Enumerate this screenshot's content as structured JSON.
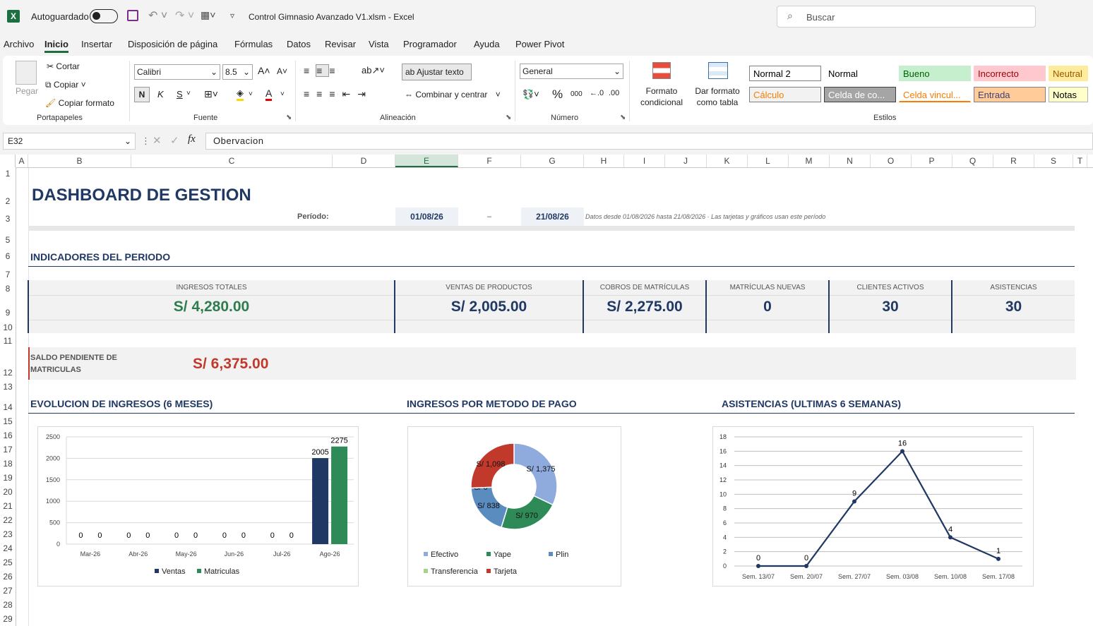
{
  "titlebar": {
    "autosave_label": "Autoguardado",
    "file_title": "Control Gimnasio Avanzado V1.xlsm  -  Excel",
    "search_placeholder": "Buscar",
    "logo": "X"
  },
  "menu": [
    "Archivo",
    "Inicio",
    "Insertar",
    "Disposición de página",
    "Fórmulas",
    "Datos",
    "Revisar",
    "Vista",
    "Programador",
    "Ayuda",
    "Power Pivot"
  ],
  "ribbon": {
    "clipboard": {
      "paste": "Pegar",
      "cut": "Cortar",
      "copy": "Copiar",
      "format_painter": "Copiar formato",
      "group": "Portapapeles"
    },
    "font": {
      "name": "Calibri",
      "size": "8.5",
      "bold": "N",
      "italic": "K",
      "underline": "S",
      "group": "Fuente"
    },
    "alignment": {
      "wrap": "Ajustar texto",
      "merge": "Combinar y centrar",
      "group": "Alineación"
    },
    "number": {
      "format": "General",
      "group": "Número",
      "percent": "%",
      "thousands": "000"
    },
    "styles": {
      "cond_format": "Formato condicional",
      "format_table": "Dar formato como tabla",
      "group": "Estilos",
      "cells": [
        {
          "label": "Normal 2",
          "bg": "#ffffff",
          "fg": "#000000",
          "border": "#7f7f7f"
        },
        {
          "label": "Normal",
          "bg": "#ffffff",
          "fg": "#000000",
          "border": "#ffffff"
        },
        {
          "label": "Bueno",
          "bg": "#c6efce",
          "fg": "#006100",
          "border": "#c6efce"
        },
        {
          "label": "Incorrecto",
          "bg": "#ffc7ce",
          "fg": "#9c0006",
          "border": "#ffc7ce"
        },
        {
          "label": "Neutral",
          "bg": "#ffeb9c",
          "fg": "#9c5700",
          "border": "#ffeb9c"
        },
        {
          "label": "Cálculo",
          "bg": "#f2f2f2",
          "fg": "#fa7d00",
          "border": "#7f7f7f"
        },
        {
          "label": "Celda de co...",
          "bg": "#a5a5a5",
          "fg": "#ffffff",
          "border": "#3f3f3f"
        },
        {
          "label": "Celda vincul...",
          "bg": "#ffffff",
          "fg": "#fa7d00",
          "border": "#ffffff"
        },
        {
          "label": "Entrada",
          "bg": "#ffcc99",
          "fg": "#3f3f76",
          "border": "#7f7f7f"
        },
        {
          "label": "Notas",
          "bg": "#ffffcc",
          "fg": "#000000",
          "border": "#b2b2b2"
        }
      ]
    }
  },
  "formula_bar": {
    "cell_ref": "E32",
    "formula": "Obervacion",
    "fx": "fx"
  },
  "columns": [
    "A",
    "B",
    "C",
    "D",
    "E",
    "F",
    "G",
    "H",
    "I",
    "J",
    "K",
    "L",
    "M",
    "N",
    "O",
    "P",
    "Q",
    "R",
    "S",
    "T"
  ],
  "rows": [
    "1",
    "2",
    "3",
    "5",
    "6",
    "7",
    "8",
    "9",
    "10",
    "11",
    "12",
    "13",
    "14",
    "15",
    "16",
    "17",
    "18",
    "19",
    "20",
    "21",
    "22",
    "23",
    "24",
    "25",
    "26",
    "27",
    "28",
    "29"
  ],
  "dashboard": {
    "title": "DASHBOARD DE GESTION",
    "period_label": "Período:",
    "date_from": "01/08/26",
    "dash": "–",
    "date_to": "21/08/26",
    "period_note": "Datos desde 01/08/2026 hasta 21/08/2026  ·  Las tarjetas y gráficos usan este período",
    "indicators_title": "INDICADORES DEL PERIODO",
    "kpis": [
      {
        "label": "INGRESOS TOTALES",
        "value": "S/ 4,280.00"
      },
      {
        "label": "VENTAS DE PRODUCTOS",
        "value": "S/ 2,005.00"
      },
      {
        "label": "COBROS DE MATRÍCULAS",
        "value": "S/ 2,275.00"
      },
      {
        "label": "MATRÍCULAS NUEVAS",
        "value": "0"
      },
      {
        "label": "CLIENTES ACTIVOS",
        "value": "30"
      },
      {
        "label": "ASISTENCIAS",
        "value": "30"
      }
    ],
    "pending": {
      "label": "SALDO PENDIENTE DE MATRICULAS",
      "value": "S/ 6,375.00"
    },
    "chart_titles": [
      "EVOLUCION DE INGRESOS (6 MESES)",
      "INGRESOS POR METODO DE PAGO",
      "ASISTENCIAS (ULTIMAS 6 SEMANAS)"
    ]
  },
  "colors": {
    "navy": "#1f3864",
    "green": "#2e7d4f",
    "red": "#c0392b",
    "bar_ventas": "#203864",
    "bar_matriculas": "#2e8b57"
  },
  "chart_data": [
    {
      "type": "bar",
      "categories": [
        "Mar-26",
        "Abr-26",
        "May-26",
        "Jun-26",
        "Jul-26",
        "Ago-26"
      ],
      "series": [
        {
          "name": "Ventas",
          "values": [
            0,
            0,
            0,
            0,
            0,
            2005
          ]
        },
        {
          "name": "Matriculas",
          "values": [
            0,
            0,
            0,
            0,
            0,
            2275
          ]
        }
      ],
      "ylim": [
        0,
        2500
      ],
      "yticks": [
        0,
        500,
        1000,
        1500,
        2000,
        2500
      ],
      "grid": true,
      "legend": "bottom"
    },
    {
      "type": "pie",
      "donut": true,
      "slices": [
        {
          "name": "Efectivo",
          "value": 1375,
          "label": "S/ 1,375",
          "color": "#8faadc"
        },
        {
          "name": "Yape",
          "value": 970,
          "label": "S/ 970",
          "color": "#2e8b57"
        },
        {
          "name": "Plin",
          "value": 838,
          "label": "S/ 838",
          "color": "#5b8cc0"
        },
        {
          "name": "Transferencia",
          "value": 0,
          "label": "S/ 0",
          "color": "#a9d18e"
        },
        {
          "name": "Tarjeta",
          "value": 1098,
          "label": "S/ 1,098",
          "color": "#c0392b"
        }
      ],
      "legend": "bottom"
    },
    {
      "type": "line",
      "categories": [
        "Sem. 13/07",
        "Sem. 20/07",
        "Sem. 27/07",
        "Sem. 03/08",
        "Sem. 10/08",
        "Sem. 17/08"
      ],
      "values": [
        0,
        0,
        9,
        16,
        4,
        1
      ],
      "ylim": [
        0,
        18
      ],
      "yticks": [
        0,
        2,
        4,
        6,
        8,
        10,
        12,
        14,
        16,
        18
      ],
      "grid": true
    }
  ]
}
